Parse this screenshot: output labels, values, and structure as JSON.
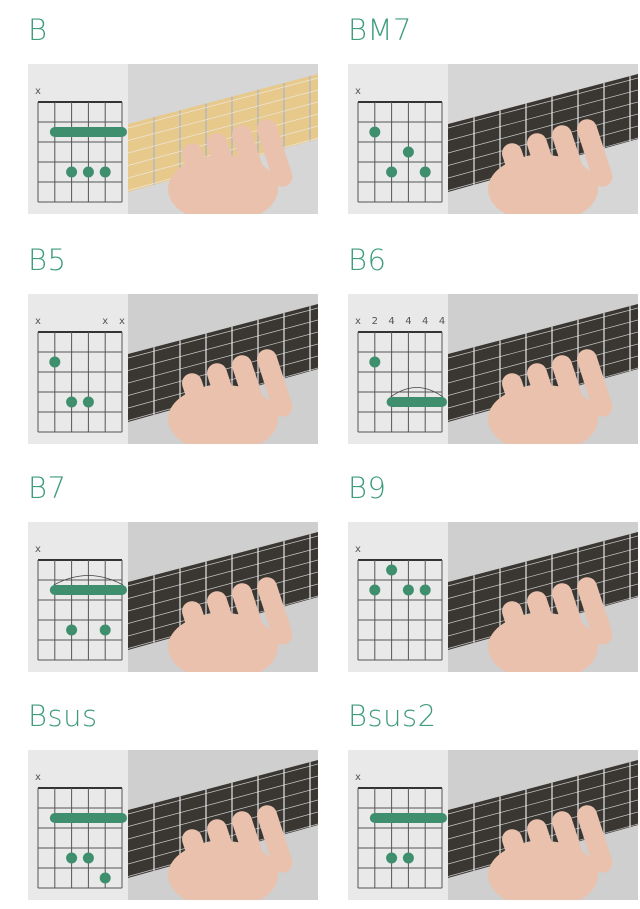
{
  "accent_color": "#3f8f6f",
  "chords": [
    {
      "name": "B",
      "strings": [
        "x",
        "",
        "",
        "",
        "",
        ""
      ],
      "barre": {
        "fret": 2,
        "from": 1,
        "to": 5,
        "arc": false
      },
      "dots": [
        {
          "string": 2,
          "fret": 4
        },
        {
          "string": 3,
          "fret": 4
        },
        {
          "string": 4,
          "fret": 4
        }
      ],
      "photo": "hand-on-fretboard-photo"
    },
    {
      "name": "BM7",
      "strings": [
        "x",
        "",
        "",
        "",
        "",
        ""
      ],
      "barre": null,
      "dots": [
        {
          "string": 1,
          "fret": 2
        },
        {
          "string": 3,
          "fret": 3
        },
        {
          "string": 2,
          "fret": 4
        },
        {
          "string": 4,
          "fret": 4
        }
      ],
      "photo": "hand-on-fretboard-photo"
    },
    {
      "name": "B5",
      "strings": [
        "x",
        "",
        "",
        "",
        "x",
        "x"
      ],
      "barre": null,
      "dots": [
        {
          "string": 1,
          "fret": 2
        },
        {
          "string": 2,
          "fret": 4
        },
        {
          "string": 3,
          "fret": 4
        }
      ],
      "photo": "hand-on-fretboard-photo"
    },
    {
      "name": "B6",
      "strings": [
        "x",
        "2",
        "4",
        "4",
        "4",
        "4"
      ],
      "barre": {
        "fret": 4,
        "from": 2,
        "to": 5,
        "arc": true
      },
      "dots": [
        {
          "string": 1,
          "fret": 2
        }
      ],
      "photo": "hand-on-fretboard-photo"
    },
    {
      "name": "B7",
      "strings": [
        "x",
        "",
        "",
        "",
        "",
        ""
      ],
      "barre": {
        "fret": 2,
        "from": 1,
        "to": 5,
        "arc": true
      },
      "dots": [
        {
          "string": 2,
          "fret": 4
        },
        {
          "string": 4,
          "fret": 4
        }
      ],
      "photo": "hand-on-fretboard-photo"
    },
    {
      "name": "B9",
      "strings": [
        "x",
        "",
        "",
        "",
        "",
        ""
      ],
      "barre": null,
      "dots": [
        {
          "string": 2,
          "fret": 1
        },
        {
          "string": 1,
          "fret": 2
        },
        {
          "string": 3,
          "fret": 2
        },
        {
          "string": 4,
          "fret": 2
        }
      ],
      "photo": "hand-on-fretboard-photo"
    },
    {
      "name": "Bsus",
      "strings": [
        "x",
        "",
        "",
        "",
        "",
        ""
      ],
      "barre": {
        "fret": 2,
        "from": 1,
        "to": 5,
        "arc": false
      },
      "dots": [
        {
          "string": 2,
          "fret": 4
        },
        {
          "string": 3,
          "fret": 4
        },
        {
          "string": 4,
          "fret": 5
        }
      ],
      "photo": "hand-on-fretboard-photo"
    },
    {
      "name": "Bsus2",
      "strings": [
        "x",
        "",
        "",
        "",
        "",
        ""
      ],
      "barre": {
        "fret": 2,
        "from": 1,
        "to": 5,
        "arc": false
      },
      "dots": [
        {
          "string": 2,
          "fret": 4
        },
        {
          "string": 3,
          "fret": 4
        }
      ],
      "photo": "hand-on-fretboard-photo"
    }
  ]
}
